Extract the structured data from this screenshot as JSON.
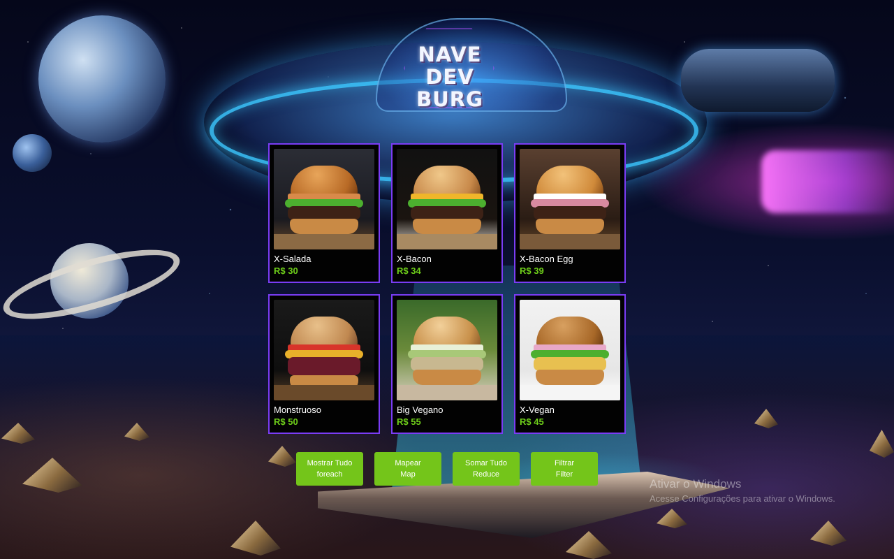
{
  "brand": {
    "logo_line1": "NAVE",
    "logo_line2": "DEV BURG"
  },
  "menu": {
    "items": [
      {
        "name": "X-Salada",
        "price": "R$ 30"
      },
      {
        "name": "X-Bacon",
        "price": "R$ 34"
      },
      {
        "name": "X-Bacon Egg",
        "price": "R$ 39"
      },
      {
        "name": "Monstruoso",
        "price": "R$ 50"
      },
      {
        "name": "Big Vegano",
        "price": "R$ 55"
      },
      {
        "name": "X-Vegan",
        "price": "R$ 45"
      }
    ]
  },
  "actions": {
    "show_all": {
      "line1": "Mostrar Tudo",
      "line2": "foreach"
    },
    "map": {
      "line1": "Mapear",
      "line2": "Map"
    },
    "reduce": {
      "line1": "Somar Tudo",
      "line2": "Reduce"
    },
    "filter": {
      "line1": "Filtrar",
      "line2": "Filter"
    }
  },
  "watermark": {
    "title": "Ativar o Windows",
    "subtitle": "Acesse Configurações para ativar o Windows."
  },
  "colors": {
    "card_border": "#7a3cf5",
    "price": "#6fcf1a",
    "button": "#74c51a"
  }
}
